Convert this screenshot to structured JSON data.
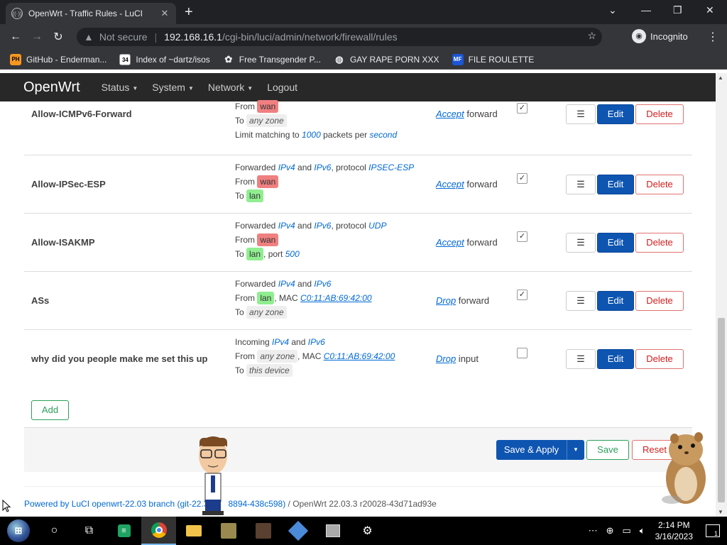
{
  "browser": {
    "tab_title": "OpenWrt - Traffic Rules - LuCI",
    "tab_close": "✕",
    "new_tab": "+",
    "window_controls": [
      "⌄",
      "—",
      "❐",
      "✕"
    ],
    "not_secure": "Not secure",
    "url_host": "192.168.16.1",
    "url_path": "/cgi-bin/luci/admin/network/firewall/rules",
    "profile_label": "Incognito",
    "bookmarks": [
      {
        "label": "GitHub - Enderman...",
        "icon": "PH",
        "color": "#f7971d"
      },
      {
        "label": "Index of ~dartz/isos",
        "icon": "34",
        "color": "#e8eaed"
      },
      {
        "label": "Free Transgender P...",
        "icon": "fox",
        "color": "#e8eaed"
      },
      {
        "label": "GAY RAPE PORN XXX",
        "icon": "globe",
        "color": "#e8eaed"
      },
      {
        "label": "FILE ROULETTE",
        "icon": "MF",
        "color": "#1a56d6"
      }
    ]
  },
  "header": {
    "brand": "OpenWrt",
    "menu": [
      "Status",
      "System",
      "Network",
      "Logout"
    ]
  },
  "rules": [
    {
      "name": "Allow-ICMPv6-Forward",
      "lines": [
        [
          {
            "t": "From "
          },
          {
            "zone": "wan",
            "kind": "wan"
          }
        ],
        [
          {
            "t": "To "
          },
          {
            "zone": "any zone",
            "kind": "any"
          }
        ],
        [
          {
            "t": "Limit matching to "
          },
          {
            "lk": "1000"
          },
          {
            "t": " packets per "
          },
          {
            "lk": "second"
          }
        ]
      ],
      "action_link": "Accept",
      "action_rest": " forward",
      "enabled": true
    },
    {
      "name": "Allow-IPSec-ESP",
      "lines": [
        [
          {
            "t": "Forwarded "
          },
          {
            "lk": "IPv4"
          },
          {
            "t": " and "
          },
          {
            "lk": "IPv6"
          },
          {
            "t": ", protocol "
          },
          {
            "lk": "IPSEC-ESP"
          }
        ],
        [
          {
            "t": "From "
          },
          {
            "zone": "wan",
            "kind": "wan"
          }
        ],
        [
          {
            "t": "To "
          },
          {
            "zone": "lan",
            "kind": "lan"
          }
        ]
      ],
      "action_link": "Accept",
      "action_rest": " forward",
      "enabled": true
    },
    {
      "name": "Allow-ISAKMP",
      "lines": [
        [
          {
            "t": "Forwarded "
          },
          {
            "lk": "IPv4"
          },
          {
            "t": " and "
          },
          {
            "lk": "IPv6"
          },
          {
            "t": ", protocol "
          },
          {
            "lk": "UDP"
          }
        ],
        [
          {
            "t": "From "
          },
          {
            "zone": "wan",
            "kind": "wan"
          }
        ],
        [
          {
            "t": "To "
          },
          {
            "zone": "lan",
            "kind": "lan"
          },
          {
            "t": ", port "
          },
          {
            "lk": "500"
          }
        ]
      ],
      "action_link": "Accept",
      "action_rest": " forward",
      "enabled": true
    },
    {
      "name": "ASs",
      "lines": [
        [
          {
            "t": "Forwarded "
          },
          {
            "lk": "IPv4"
          },
          {
            "t": " and "
          },
          {
            "lk": "IPv6"
          }
        ],
        [
          {
            "t": "From "
          },
          {
            "zone": "lan",
            "kind": "lan"
          },
          {
            "t": ", MAC "
          },
          {
            "lku": "C0:11:AB:69:42:00"
          }
        ],
        [
          {
            "t": "To "
          },
          {
            "zone": "any zone",
            "kind": "any"
          }
        ]
      ],
      "action_link": "Drop",
      "action_rest": " forward",
      "enabled": true
    },
    {
      "name": "why did you people make me set this up",
      "lines": [
        [
          {
            "t": "Incoming "
          },
          {
            "lk": "IPv4"
          },
          {
            "t": " and "
          },
          {
            "lk": "IPv6"
          }
        ],
        [
          {
            "t": "From "
          },
          {
            "zone": "any zone",
            "kind": "any"
          },
          {
            "t": ", MAC "
          },
          {
            "lku": "C0:11:AB:69:42:00"
          }
        ],
        [
          {
            "t": "To "
          },
          {
            "zone": "this device",
            "kind": "any"
          }
        ]
      ],
      "action_link": "Drop",
      "action_rest": " input",
      "enabled": false
    }
  ],
  "row_buttons": {
    "sort": "☰",
    "edit": "Edit",
    "delete": "Delete"
  },
  "add_label": "Add",
  "actions": {
    "save_apply": "Save & Apply",
    "save": "Save",
    "reset": "Reset"
  },
  "footer": {
    "link": "Powered by LuCI openwrt-22.03 branch (git-22.3",
    "link_tail": "8894-438c598)",
    "rest": " / OpenWrt 22.03.3 r20028-43d71ad93e"
  },
  "taskbar": {
    "clock_time": "2:14 PM",
    "clock_date": "3/16/2023",
    "notif_count": "1",
    "apps": [
      "search",
      "task-view",
      "sheets",
      "chrome",
      "explorer",
      "app1",
      "app2",
      "app3",
      "app4",
      "settings"
    ]
  }
}
